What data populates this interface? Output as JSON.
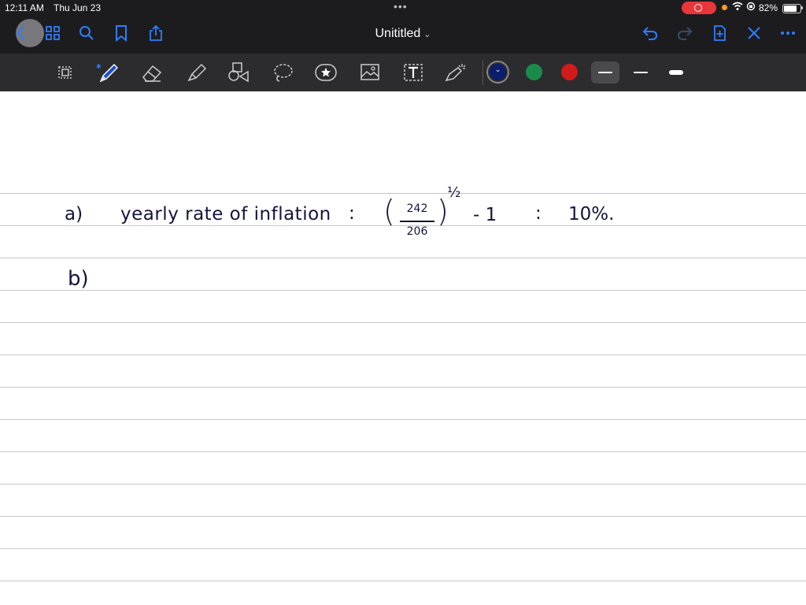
{
  "status_bar": {
    "time": "12:11 AM",
    "date": "Thu Jun 23",
    "battery_pct": "82%",
    "battery_level": 0.82,
    "record_color": "#e8363a"
  },
  "nav": {
    "title": "Unititled",
    "accent_color": "#2f7dff",
    "icons": [
      "back-icon",
      "grid-icon",
      "search-icon",
      "bookmark-icon",
      "share-icon",
      "undo-icon",
      "redo-icon",
      "add-page-icon",
      "close-icon",
      "more-icon"
    ]
  },
  "toolbar": {
    "tools": [
      "lasso-select-icon",
      "pen-icon",
      "eraser-icon",
      "highlighter-icon",
      "shapes-icon",
      "lasso-icon",
      "sticker-icon",
      "image-icon",
      "text-icon",
      "laser-pointer-icon"
    ],
    "colors": [
      "#0b1e6e",
      "#1a8c4a",
      "#d11a1a"
    ],
    "selected_color": "#0b1e6e",
    "stroke_widths": [
      "thin",
      "medium",
      "thick"
    ],
    "selected_stroke": "thin"
  },
  "note": {
    "line_a": {
      "label": "a)",
      "text": "yearly rate of inflation",
      "equals": ":",
      "numerator": "242",
      "denominator": "206",
      "exponent": "½",
      "minus_one": "- 1",
      "equals2": ":",
      "result": "10%."
    },
    "line_b": {
      "label": "b)"
    }
  }
}
